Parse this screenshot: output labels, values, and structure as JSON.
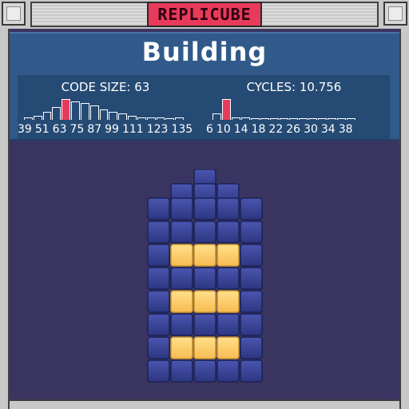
{
  "app": {
    "title": "REPLICUBE"
  },
  "header": {
    "status": "Building"
  },
  "stats": {
    "code_size": {
      "label": "CODE SIZE: 63",
      "ticks": [
        "39",
        "51",
        "63",
        "75",
        "87",
        "99",
        "111",
        "123",
        "135"
      ],
      "histogram": [
        1,
        2,
        4,
        6,
        10,
        9,
        8,
        7,
        5,
        4,
        3,
        2,
        1,
        1,
        1,
        0,
        1
      ],
      "highlight_index": 4
    },
    "cycles": {
      "label": "CYCLES: 10.756",
      "ticks": [
        "6",
        "10",
        "14",
        "18",
        "22",
        "26",
        "30",
        "34",
        "38"
      ],
      "histogram": [
        3,
        10,
        1,
        1,
        0,
        0,
        0,
        0,
        0,
        0,
        0,
        0,
        0,
        0,
        0
      ],
      "highlight_index": 1
    }
  },
  "colors": {
    "title_tab": "#e83a5a",
    "header": "#315a8a",
    "viewport": "#393560",
    "cube_blue": "#2c3680",
    "cube_gold": "#ffcc66"
  }
}
